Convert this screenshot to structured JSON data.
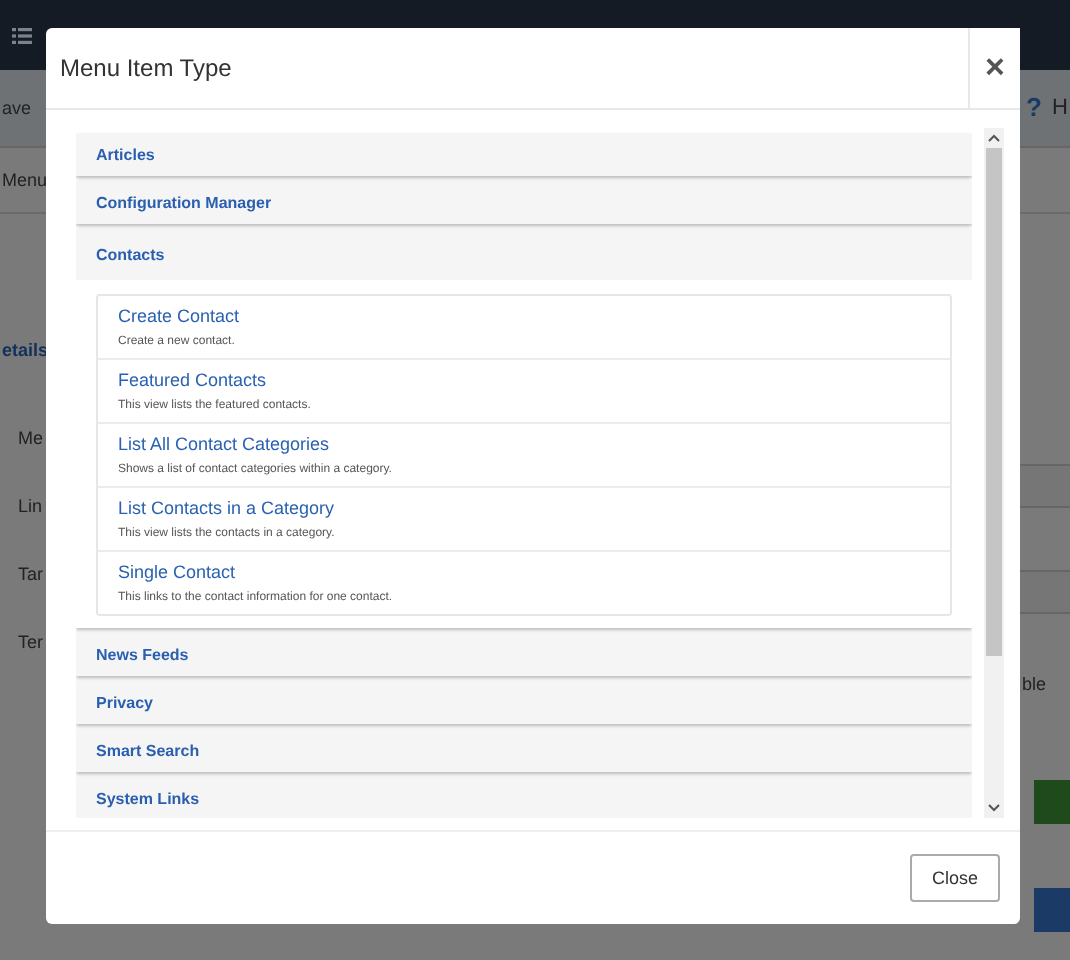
{
  "background": {
    "toolbar_button": "ave",
    "help_icon": "?",
    "help": "H",
    "tab": "Menu",
    "section_tab": "etails",
    "field_labels": [
      "Me",
      "Lin",
      "Tar",
      "Ter"
    ],
    "side_text": "ble"
  },
  "window": {
    "title": "Menu Item Type",
    "close": "×"
  },
  "groups": [
    {
      "label": "Articles",
      "expanded": false
    },
    {
      "label": "Configuration Manager",
      "expanded": false
    },
    {
      "label": "Contacts",
      "expanded": true,
      "items": [
        {
          "title": "Create Contact",
          "description": "Create a new contact."
        },
        {
          "title": "Featured Contacts",
          "description": "This view lists the featured contacts."
        },
        {
          "title": "List All Contact Categories",
          "description": "Shows a list of contact categories within a category."
        },
        {
          "title": "List Contacts in a Category",
          "description": "This view lists the contacts in a category."
        },
        {
          "title": "Single Contact",
          "description": "This links to the contact information for one contact."
        }
      ]
    },
    {
      "label": "News Feeds",
      "expanded": false
    },
    {
      "label": "Privacy",
      "expanded": false
    },
    {
      "label": "Smart Search",
      "expanded": false
    },
    {
      "label": "System Links",
      "expanded": false
    }
  ],
  "footer": {
    "button": "Close"
  }
}
